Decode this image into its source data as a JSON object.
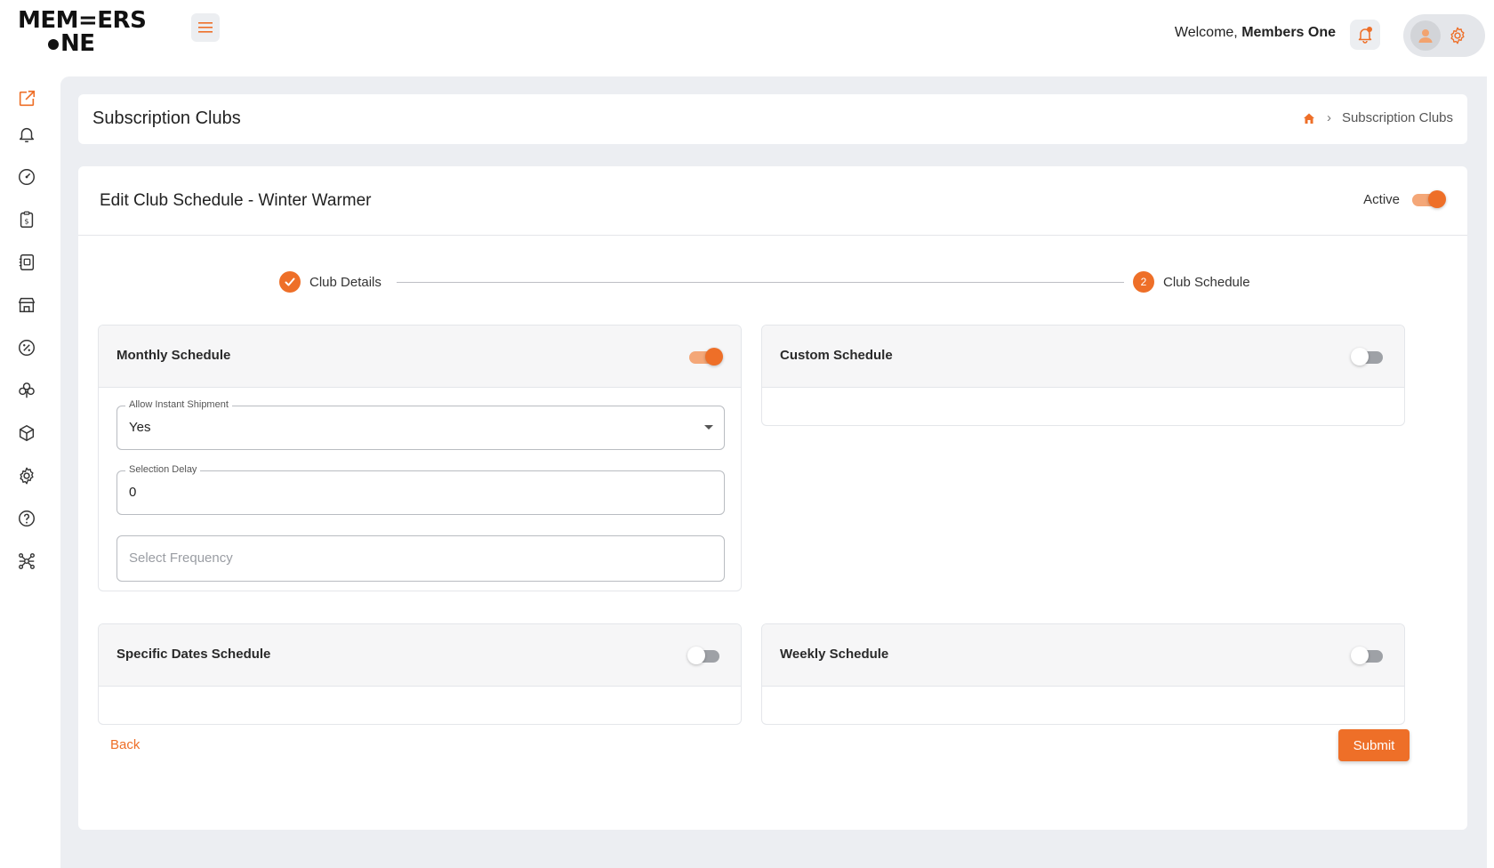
{
  "brand": {
    "line1": "MEM=ERS",
    "line2": "NE"
  },
  "header": {
    "welcome_prefix": "Welcome, ",
    "user_name": "Members One"
  },
  "sidebar": {
    "items": [
      {
        "icon": "external-link-icon",
        "active": true
      },
      {
        "icon": "bell-icon"
      },
      {
        "icon": "dashboard-gauge-icon"
      },
      {
        "icon": "invoice-dollar-icon"
      },
      {
        "icon": "contacts-book-icon"
      },
      {
        "icon": "store-icon"
      },
      {
        "icon": "discount-percent-icon"
      },
      {
        "icon": "club-icon"
      },
      {
        "icon": "package-box-icon"
      },
      {
        "icon": "settings-gear-icon"
      },
      {
        "icon": "help-question-icon"
      },
      {
        "icon": "integrations-network-icon"
      }
    ]
  },
  "page": {
    "title": "Subscription Clubs",
    "breadcrumb": {
      "current": "Subscription Clubs"
    }
  },
  "form": {
    "title": "Edit Club Schedule - Winter Warmer",
    "active_label": "Active",
    "active_on": true,
    "steps": [
      {
        "label": "Club Details",
        "status": "complete"
      },
      {
        "number": "2",
        "label": "Club Schedule",
        "status": "current"
      }
    ],
    "panels": {
      "monthly": {
        "title": "Monthly Schedule",
        "enabled": true,
        "fields": {
          "instant_shipment": {
            "label": "Allow Instant Shipment",
            "value": "Yes"
          },
          "selection_delay": {
            "label": "Selection Delay",
            "value": "0"
          },
          "frequency": {
            "placeholder": "Select Frequency"
          }
        }
      },
      "custom": {
        "title": "Custom Schedule",
        "enabled": false
      },
      "specific_dates": {
        "title": "Specific Dates Schedule",
        "enabled": false
      },
      "weekly": {
        "title": "Weekly Schedule",
        "enabled": false
      }
    },
    "back_label": "Back",
    "submit_label": "Submit"
  },
  "colors": {
    "accent": "#ee6f28",
    "background": "#eceef2"
  }
}
